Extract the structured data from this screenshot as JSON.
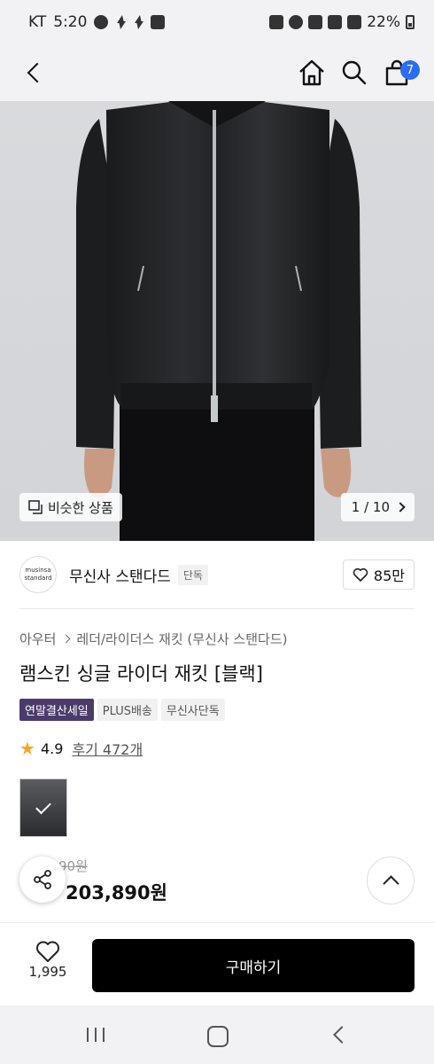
{
  "status_bar": {
    "carrier": "KT",
    "time": "5:20",
    "battery": "22%"
  },
  "header": {
    "cart_count": "7"
  },
  "hero": {
    "similar_label": "비슷한 상품",
    "pager": "1 / 10"
  },
  "brand": {
    "logo_line1": "musinsa",
    "logo_line2": "standard",
    "name": "무신사 스탠다드",
    "tag": "단독",
    "likes": "85만"
  },
  "breadcrumb": {
    "category": "아우터",
    "subcategory": "레더/라이더스 재킷 (무신사 스탠다드)"
  },
  "product": {
    "title": "램스킨 싱글 라이더 재킷 [블랙]",
    "badges": [
      "연말결산세일",
      "PLUS배송",
      "무신사단독"
    ],
    "rating": "4.9",
    "reviews": "후기 472개",
    "original_price": "90원",
    "discount": "",
    "sale_price": "203,890원"
  },
  "bottom_bar": {
    "wish_count": "1,995",
    "buy_label": "구매하기"
  }
}
